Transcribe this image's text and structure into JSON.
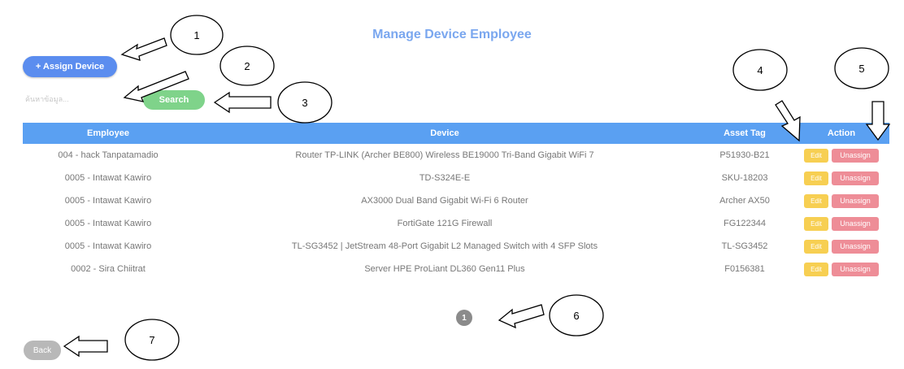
{
  "page": {
    "title": "Manage Device Employee"
  },
  "toolbar": {
    "assign_label": "+ Assign Device",
    "search_placeholder": "ค้นหาข้อมูล...",
    "search_label": "Search"
  },
  "table": {
    "columns": [
      "Employee",
      "Device",
      "Asset Tag",
      "Action"
    ],
    "rows": [
      {
        "employee": "004 - hack Tanpatamadio",
        "device": "Router TP-LINK (Archer BE800) Wireless BE19000 Tri-Band Gigabit WiFi 7",
        "asset_tag": "P51930-B21"
      },
      {
        "employee": "0005 - Intawat Kawiro",
        "device": "TD-S324E-E",
        "asset_tag": "SKU-18203"
      },
      {
        "employee": "0005 - Intawat Kawiro",
        "device": "AX3000 Dual Band Gigabit Wi-Fi 6 Router",
        "asset_tag": "Archer AX50"
      },
      {
        "employee": "0005 - Intawat Kawiro",
        "device": "FortiGate 121G Firewall",
        "asset_tag": "FG122344"
      },
      {
        "employee": "0005 - Intawat Kawiro",
        "device": "TL-SG3452 | JetStream 48-Port Gigabit L2 Managed Switch with 4 SFP Slots",
        "asset_tag": "TL-SG3452"
      },
      {
        "employee": "0002 - Sira Chiitrat",
        "device": "Server HPE ProLiant DL360 Gen11 Plus",
        "asset_tag": "F0156381"
      }
    ],
    "edit_label": "Edit",
    "unassign_label": "Unassign"
  },
  "pagination": {
    "current": "1"
  },
  "footer": {
    "back_label": "Back"
  },
  "annotations": [
    "1",
    "2",
    "3",
    "4",
    "5",
    "6",
    "7"
  ],
  "colors": {
    "title": "#7aa7ef",
    "primary": "#5b8def",
    "header": "#5aa0f2",
    "search": "#7fd38a",
    "edit": "#f7cf52",
    "unassign": "#ee8d97",
    "back": "#b8b8b8"
  }
}
